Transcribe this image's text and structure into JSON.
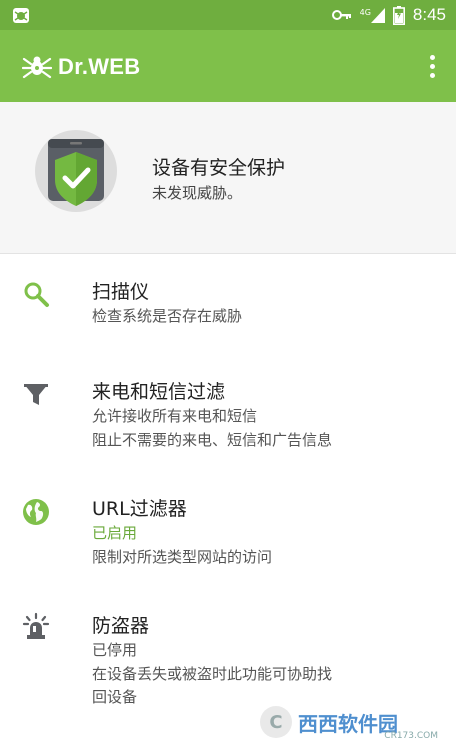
{
  "statusbar": {
    "network": "4G",
    "time": "8:45",
    "icons": [
      "dr-web-spider-icon",
      "key-icon",
      "signal-icon",
      "battery-icon"
    ]
  },
  "appbar": {
    "logo_text": "Dr.WEB",
    "menu_icon": "overflow-menu-icon"
  },
  "protection": {
    "title": "设备有安全保护",
    "subtitle": "未发现威胁。",
    "icon": "shield-check-icon"
  },
  "features": [
    {
      "icon": "search-icon",
      "title": "扫描仪",
      "lines": [
        "检查系统是否存在威胁"
      ]
    },
    {
      "icon": "filter-icon",
      "title": "来电和短信过滤",
      "lines": [
        "允许接收所有来电和短信",
        "阻止不需要的来电、短信和广告信息"
      ]
    },
    {
      "icon": "globe-icon",
      "title": "URL过滤器",
      "status": "已启用",
      "lines": [
        "限制对所选类型网站的访问"
      ]
    },
    {
      "icon": "alarm-beacon-icon",
      "title": "防盗器",
      "status": "已停用",
      "lines": [
        "在设备丢失或被盗时此功能可协助找",
        "回设备"
      ]
    }
  ],
  "watermark": {
    "text": "西西软件园",
    "sub": "CR173.COM"
  },
  "colors": {
    "accent": "#7fc04a",
    "status_bar": "#6fae3f",
    "enabled_green": "#6aa93a"
  }
}
